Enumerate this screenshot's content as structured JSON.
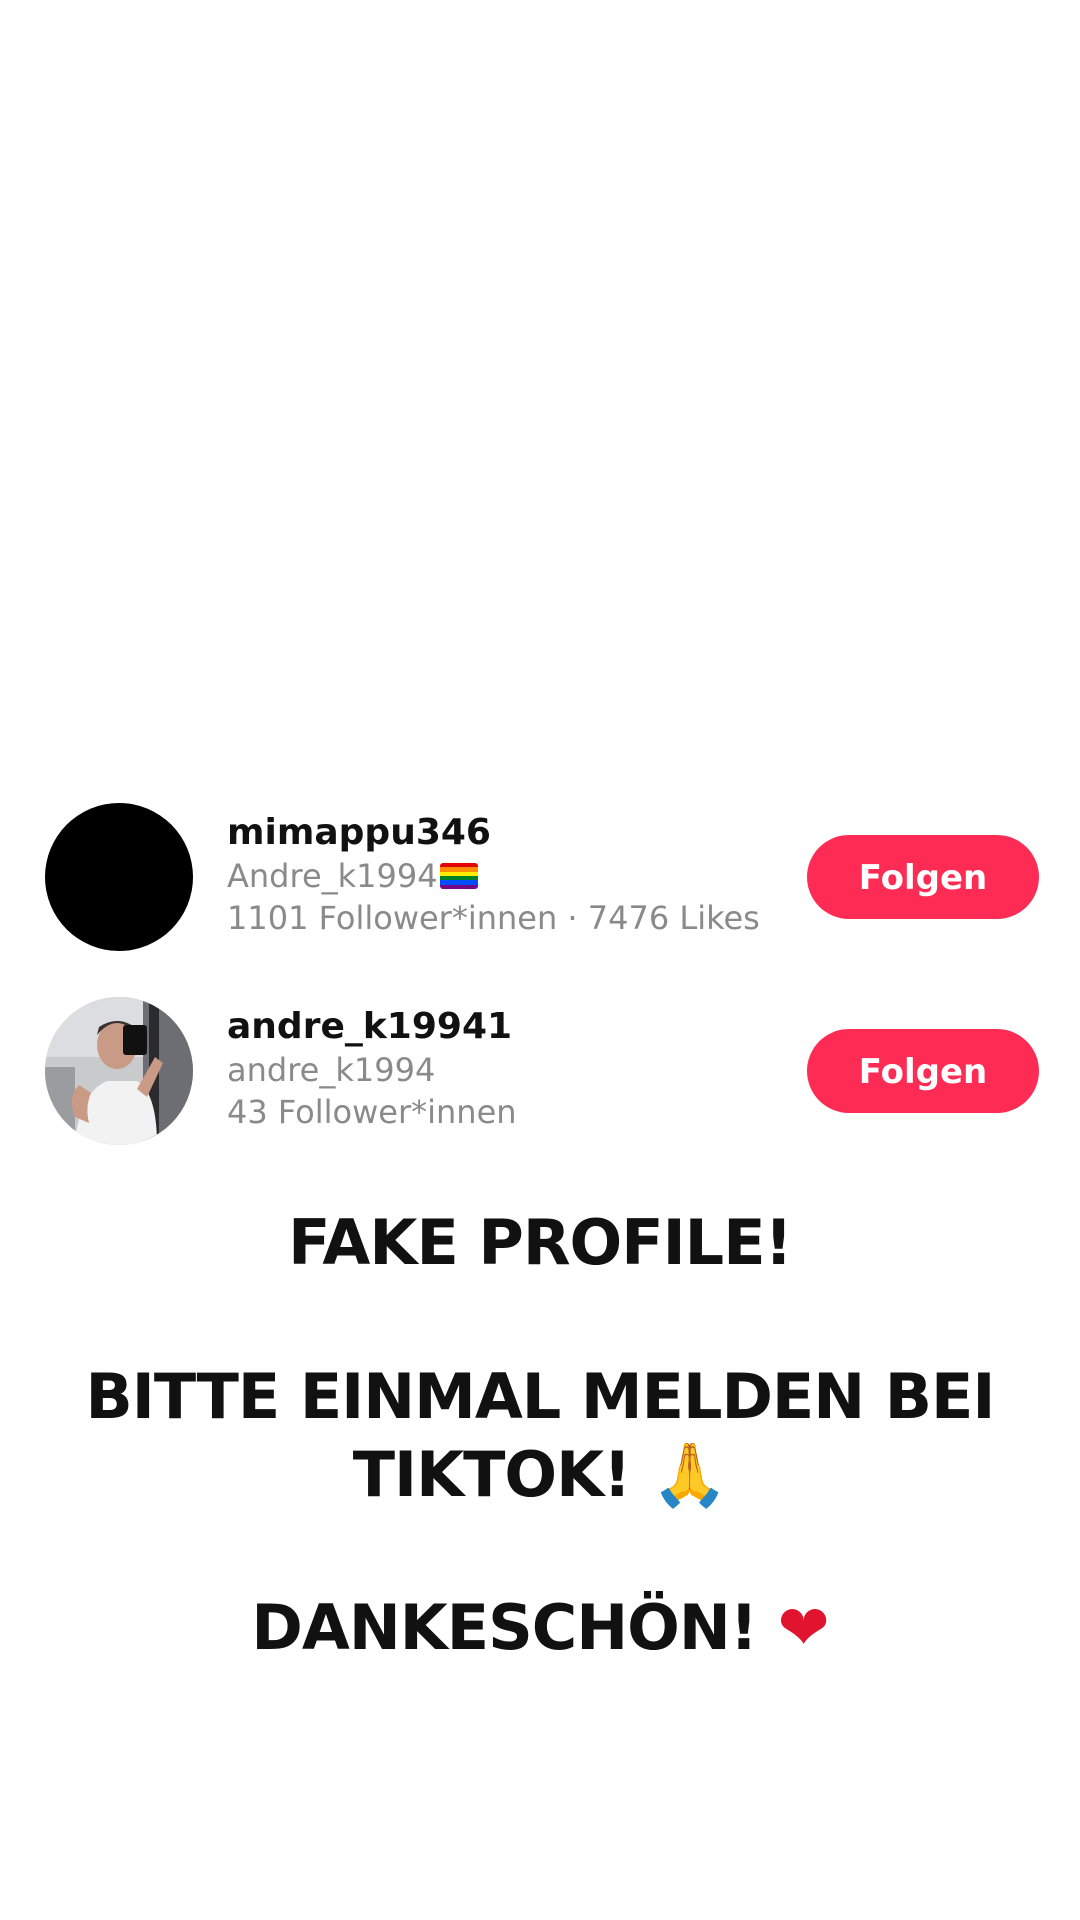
{
  "users": [
    {
      "username": "mimappu346",
      "display_name": "Andre_k1994",
      "display_flag_icon": "rainbow-flag-icon",
      "stats": "1101 Follower*innen · 7476 Likes",
      "follow_label": "Folgen",
      "avatar": "black-avatar"
    },
    {
      "username": "andre_k19941",
      "display_name": "andre_k1994",
      "stats": "43 Follower*innen",
      "follow_label": "Folgen",
      "avatar": "photo-avatar"
    }
  ],
  "message": {
    "line1": "FAKE PROFILE!",
    "line2": "BITTE EINMAL MELDEN BEI",
    "line3": "TIKTOK!",
    "line3_emoji": "🙏",
    "line4": "DANKESCHÖN!",
    "line4_emoji": "❤"
  },
  "colors": {
    "follow_button": "#fe2c55",
    "secondary_text": "#8a8a8a",
    "primary_text": "#111111"
  }
}
